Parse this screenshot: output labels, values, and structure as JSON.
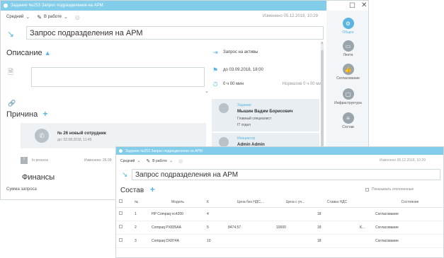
{
  "main_window": {
    "title": "Задание №253 Запрос подразделения на АРМ",
    "toolbar": {
      "priority": "Средний",
      "status": "В работе",
      "modified": "Изменено 05.12.2018, 10:29"
    },
    "task_title": "Запрос подразделения на АРМ",
    "description_heading": "Описание",
    "reason_heading": "Причина",
    "reason_item": {
      "title": "№ 26 новый сотрудник",
      "date": "до: 02.08.2018, 11:45"
    },
    "process_row": {
      "status": "In process",
      "modified": "Изменено: 26.09"
    },
    "finance_heading": "Финансы",
    "request_sum_label": "Сумма запроса",
    "right_panel": {
      "type": "Запрос на активы",
      "deadline": "до 03.09.2018, 18:00",
      "duration": "0 ч 00 мин",
      "norm": "Норматив 0 ч 00 мин",
      "assignee_label": "Задание",
      "assignee_name": "Мышин Вадим Борисович",
      "assignee_role": "Главный специалист",
      "assignee_dept": "IT отдел",
      "initiator_label": "Инициатор",
      "initiator_name": "Admin Admin"
    },
    "sidebar": [
      {
        "label": "Общее",
        "icon": "gear-icon"
      },
      {
        "label": "Лента",
        "icon": "feed-icon"
      },
      {
        "label": "Согласование",
        "icon": "thumb-up-icon"
      },
      {
        "label": "Инфраструктура",
        "icon": "monitor-icon"
      },
      {
        "label": "Состав",
        "icon": "stack-icon"
      }
    ],
    "window_controls": {
      "maximize": "☐",
      "close": "✕"
    }
  },
  "second_window": {
    "title": "Задание №253 Запрос подразделения на АРМ",
    "toolbar": {
      "priority": "Средний",
      "status": "В работе",
      "modified": "Изменено 05.12.2018, 10:29"
    },
    "task_title": "Запрос подразделения на АРМ",
    "composition_heading": "Состав",
    "show_rejected_label": "Показывать отклоненные",
    "columns": [
      "№",
      "Модель",
      "К",
      "Цена без НДС,...",
      "Цена с уч...",
      "Ставка НДС",
      "",
      "Состояние"
    ],
    "rows": [
      {
        "n": "1",
        "model": "HP Compaq nc4200",
        "k": "4",
        "price_no_vat": "",
        "price_vat": "",
        "vat": "18",
        "extra": "",
        "state": "Согласование"
      },
      {
        "n": "2",
        "model": "Compaq PX835AA",
        "k": "5",
        "price_no_vat": "8474.57",
        "price_vat": "10000",
        "vat": "18",
        "extra": "К...",
        "state": "Согласование"
      },
      {
        "n": "3",
        "model": "Compaq DX874A",
        "k": "10",
        "price_no_vat": "",
        "price_vat": "",
        "vat": "18",
        "extra": "",
        "state": "Согласование"
      }
    ]
  },
  "colors": {
    "accent": "#5ab4e0",
    "titlebar": "#82cde9"
  }
}
